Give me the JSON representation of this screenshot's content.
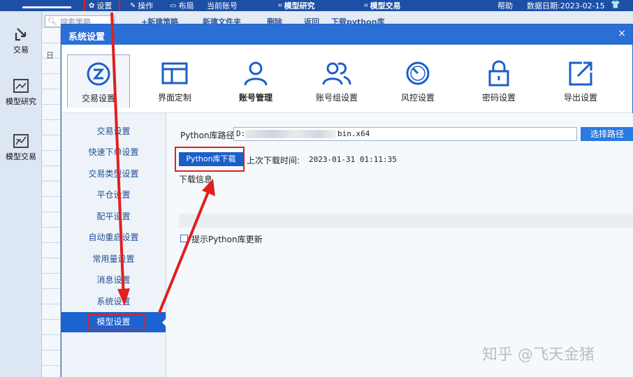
{
  "topbar": {
    "settings": "设置",
    "operate": "操作",
    "layout": "布局",
    "current_account": "当前账号",
    "model_research": "模型研究",
    "model_trading": "模型交易",
    "help": "帮助",
    "data_date": "数据日期:2023-02-15"
  },
  "rail": {
    "trade": "交易",
    "model_research": "模型研究",
    "model_trading": "模型交易"
  },
  "bg": {
    "search_placeholder": "搜索策略",
    "toolbar": [
      "+新建策略",
      "新建文件夹",
      "删除",
      "返回",
      "下载python库"
    ],
    "grid_char": "日"
  },
  "dialog": {
    "title": "系统设置",
    "close": "×",
    "tabs": [
      {
        "label": "交易设置",
        "icon": "trade-settings-icon"
      },
      {
        "label": "界面定制",
        "icon": "layout-icon"
      },
      {
        "label": "账号管理",
        "icon": "user-icon"
      },
      {
        "label": "账号组设置",
        "icon": "user-group-icon"
      },
      {
        "label": "风控设置",
        "icon": "gauge-icon"
      },
      {
        "label": "密码设置",
        "icon": "lock-icon"
      },
      {
        "label": "导出设置",
        "icon": "export-icon"
      }
    ],
    "nav": [
      "交易设置",
      "快速下单设置",
      "交易类型设置",
      "平仓设置",
      "配平设置",
      "自动重启设置",
      "常用量设置",
      "消息设置",
      "系统设置",
      "模型设置"
    ],
    "panel": {
      "python_path_label": "Python库路径",
      "path_prefix": "D:",
      "path_suffix": "bin.x64",
      "choose_path": "选择路径",
      "download_button": "Python库下载",
      "last_download_label": "上次下载时间:",
      "last_download_time": "2023-01-31 01:11:35",
      "download_info_label": "下载信息",
      "update_prompt": "提示Python库更新"
    }
  },
  "watermark": "知乎 @飞天金猪",
  "colors": {
    "accent": "#2a6fd6",
    "highlight": "#e02020",
    "nav_active": "#1a63d0"
  }
}
